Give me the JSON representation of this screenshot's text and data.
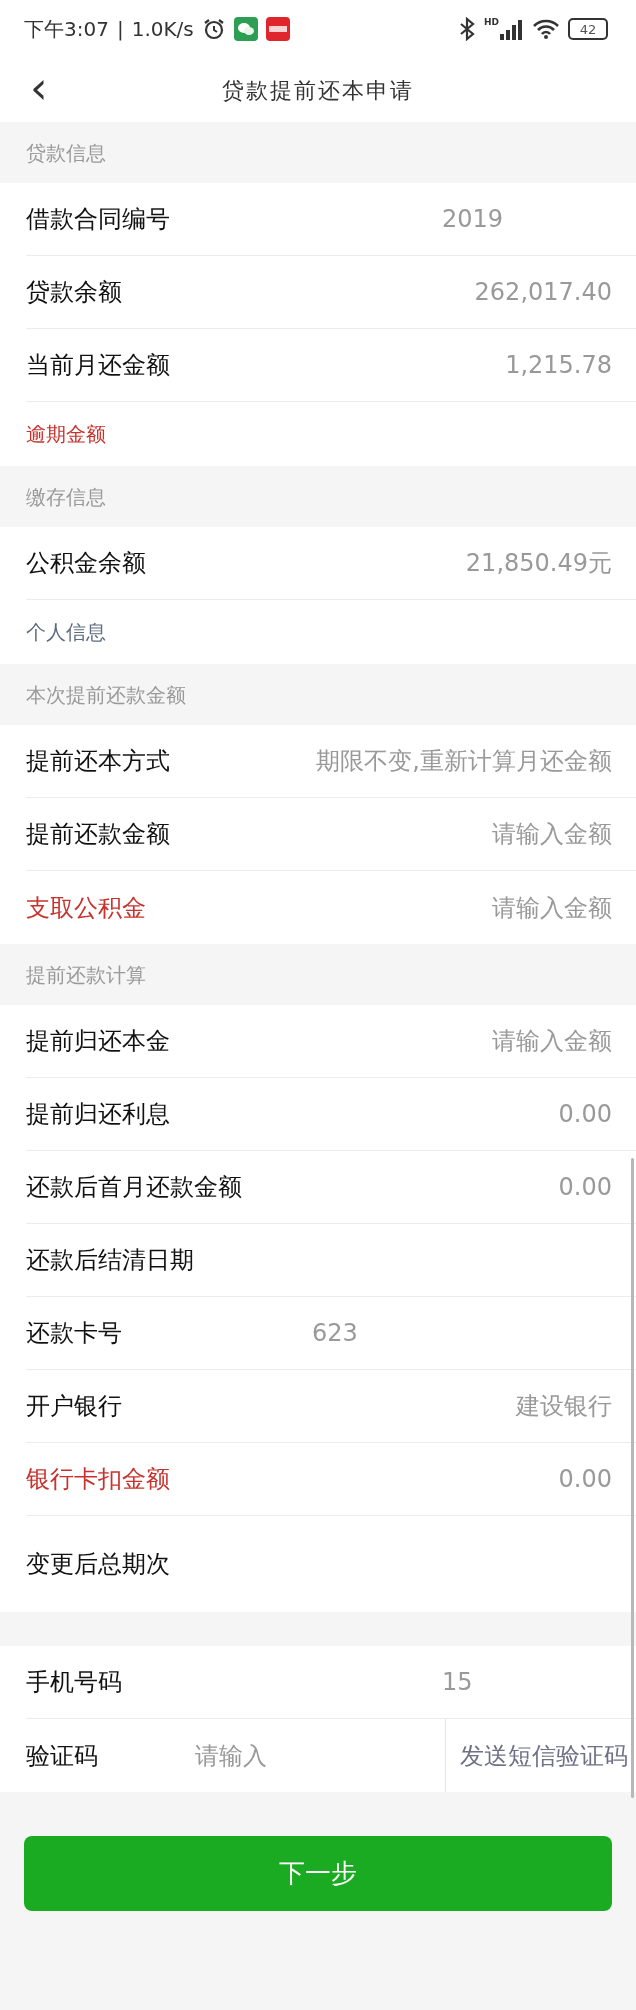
{
  "status_bar": {
    "time": "下午3:07",
    "separator": "|",
    "speed": "1.0K/s",
    "signal_label": "HD",
    "battery": "42"
  },
  "header": {
    "back": "‹",
    "title": "贷款提前还本申请"
  },
  "sections": [
    {
      "title": "贷款信息",
      "rows": [
        {
          "kind": "mid",
          "label": "借款合同编号",
          "value": "2019"
        },
        {
          "kind": "right",
          "label": "贷款余额",
          "value": "262,017.40"
        },
        {
          "kind": "right",
          "label": "当前月还金额",
          "value": "1,215.78"
        },
        {
          "kind": "minor",
          "label": "逾期金额",
          "color": "#c8322d"
        }
      ]
    },
    {
      "title": "缴存信息",
      "rows": [
        {
          "kind": "right",
          "label": "公积金余额",
          "value": "21,850.49元"
        },
        {
          "kind": "minor",
          "label": "个人信息",
          "color": "#5c6b80"
        }
      ]
    },
    {
      "title": "本次提前还款金额",
      "rows": [
        {
          "kind": "right",
          "label": "提前还本方式",
          "value": "期限不变,重新计算月还金额"
        },
        {
          "kind": "right",
          "label": "提前还款金额",
          "placeholder": "请输入金额"
        },
        {
          "kind": "right",
          "label": "支取公积金",
          "placeholder": "请输入金额",
          "color": "#c8322d"
        }
      ]
    },
    {
      "title": "提前还款计算",
      "rows": [
        {
          "kind": "right",
          "label": "提前归还本金",
          "placeholder": "请输入金额"
        },
        {
          "kind": "right",
          "label": "提前归还利息",
          "value": "0.00"
        },
        {
          "kind": "right",
          "label": "还款后首月还款金额",
          "value": "0.00"
        },
        {
          "kind": "right",
          "label": "还款后结清日期"
        },
        {
          "kind": "near",
          "label": "还款卡号",
          "value": "623"
        },
        {
          "kind": "right",
          "label": "开户银行",
          "value": "建设银行"
        },
        {
          "kind": "right",
          "label": "银行卡扣金额",
          "value": "0.00",
          "color": "#c8322d"
        },
        {
          "kind": "tall",
          "label": "变更后总期次"
        }
      ]
    },
    {
      "rows": [
        {
          "kind": "mid",
          "label": "手机号码",
          "value": "15"
        },
        {
          "kind": "code",
          "label": "验证码",
          "placeholder": "请输入",
          "action": "发送短信验证码"
        }
      ]
    }
  ],
  "next_button": "下一步"
}
